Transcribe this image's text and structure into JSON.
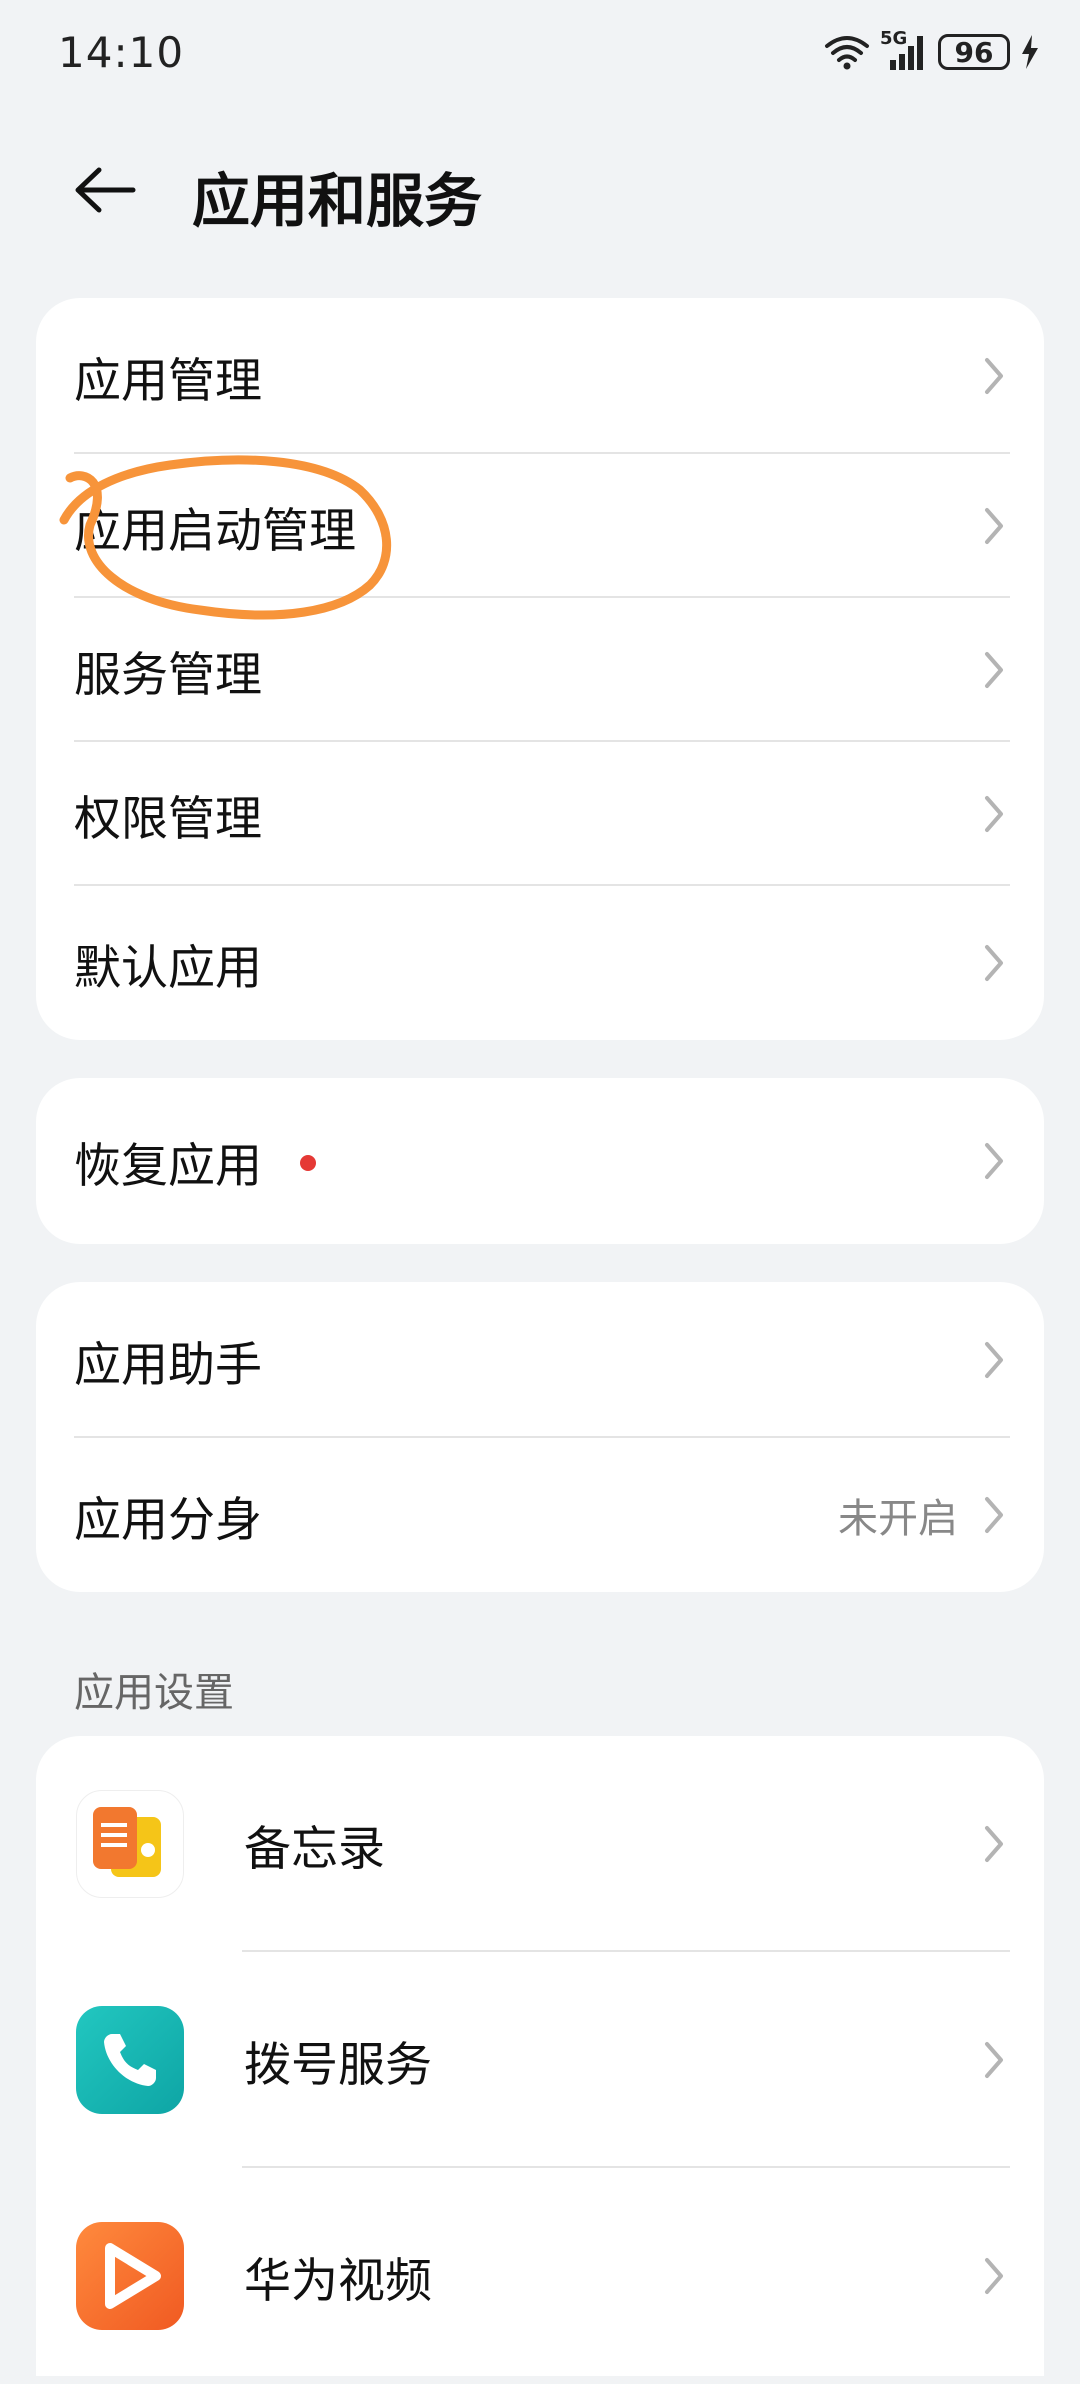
{
  "status_bar": {
    "time": "14:10",
    "network": "5G",
    "battery": "96"
  },
  "header": {
    "title": "应用和服务"
  },
  "group1": {
    "items": [
      {
        "label": "应用管理"
      },
      {
        "label": "应用启动管理"
      },
      {
        "label": "服务管理"
      },
      {
        "label": "权限管理"
      },
      {
        "label": "默认应用"
      }
    ]
  },
  "group2": {
    "items": [
      {
        "label": "恢复应用"
      }
    ]
  },
  "group3": {
    "items": [
      {
        "label": "应用助手"
      },
      {
        "label": "应用分身",
        "value": "未开启"
      }
    ]
  },
  "app_settings": {
    "section_label": "应用设置",
    "apps": [
      {
        "label": "备忘录",
        "icon": "notepad-icon"
      },
      {
        "label": "拨号服务",
        "icon": "phone-icon"
      },
      {
        "label": "华为视频",
        "icon": "video-icon"
      }
    ]
  },
  "colors": {
    "background": "#f1f3f5",
    "card": "#ffffff",
    "annotation": "#f7943a",
    "badge": "#e53935"
  }
}
